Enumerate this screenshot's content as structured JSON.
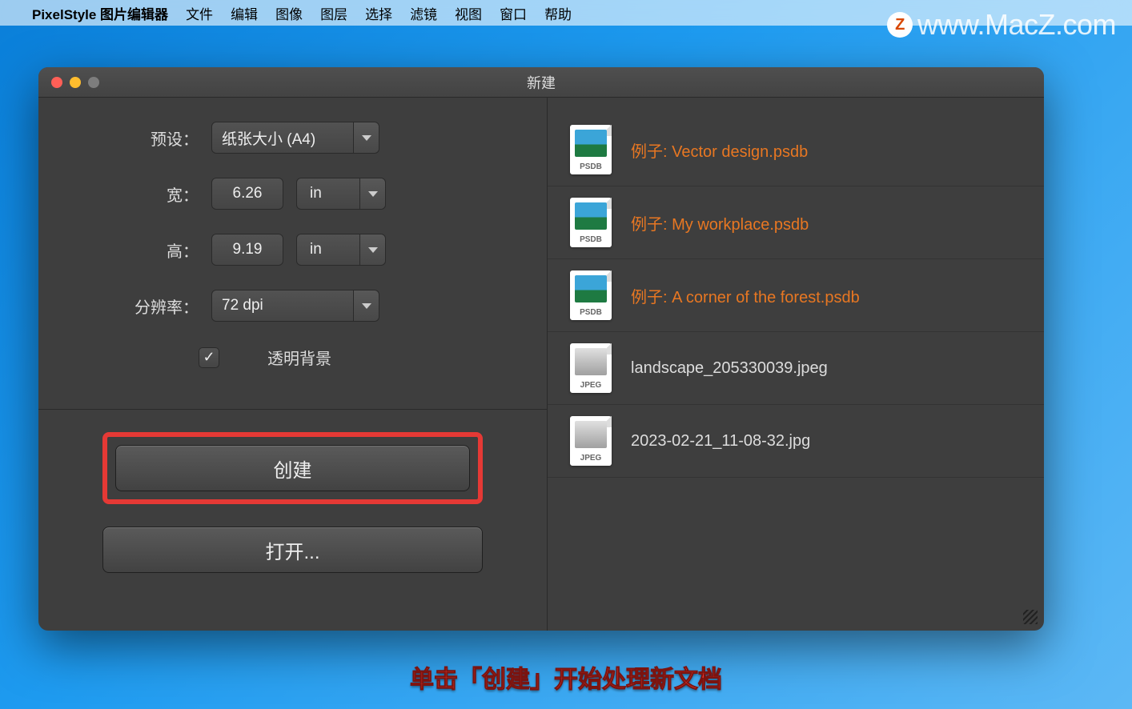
{
  "menubar": {
    "apple_icon": "",
    "app_name": "PixelStyle 图片编辑器",
    "items": [
      "文件",
      "编辑",
      "图像",
      "图层",
      "选择",
      "滤镜",
      "视图",
      "窗口",
      "帮助"
    ]
  },
  "watermark": {
    "icon_letter": "Z",
    "text": "www.MacZ.com"
  },
  "dialog": {
    "title": "新建",
    "form": {
      "preset_label": "预设：",
      "preset_value": "纸张大小 (A4)",
      "width_label": "宽：",
      "width_value": "6.26",
      "width_unit": "in",
      "height_label": "高：",
      "height_value": "9.19",
      "height_unit": "in",
      "resolution_label": "分辨率：",
      "resolution_value": "72 dpi",
      "transparent_bg_label": "透明背景",
      "transparent_bg_checked": true
    },
    "buttons": {
      "create": "创建",
      "open": "打开..."
    },
    "files": [
      {
        "name": "例子: Vector design.psdb",
        "type": "PSDB",
        "example": true
      },
      {
        "name": "例子: My workplace.psdb",
        "type": "PSDB",
        "example": true
      },
      {
        "name": "例子: A corner of the forest.psdb",
        "type": "PSDB",
        "example": true
      },
      {
        "name": "landscape_205330039.jpeg",
        "type": "JPEG",
        "example": false
      },
      {
        "name": "2023-02-21_11-08-32.jpg",
        "type": "JPEG",
        "example": false
      }
    ]
  },
  "caption": "单击「创建」开始处理新文档"
}
